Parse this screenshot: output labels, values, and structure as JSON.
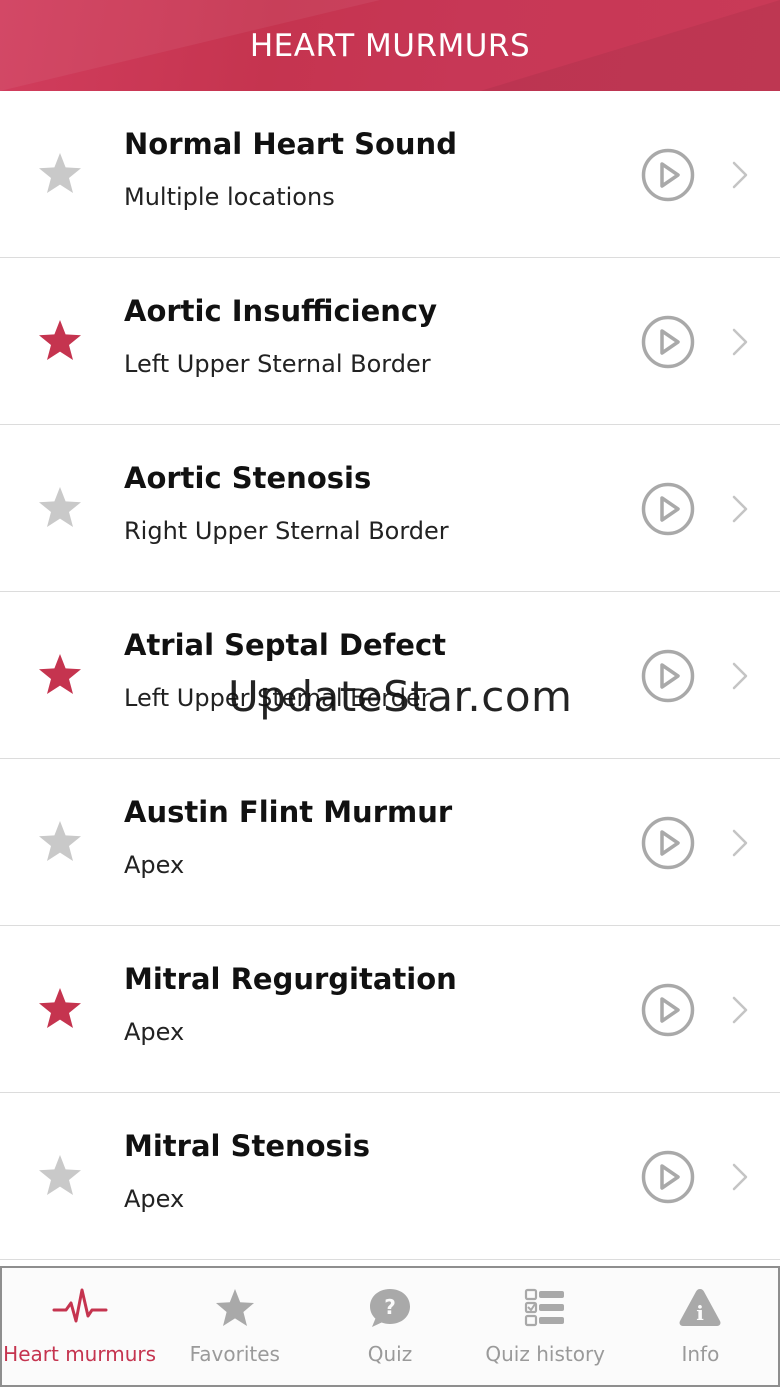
{
  "header": {
    "title": "HEART MURMURS"
  },
  "colors": {
    "accent": "#c5344f",
    "star_off": "#c9c9c9",
    "icon_gray": "#a9a9a9"
  },
  "rows": [
    {
      "name": "Normal Heart Sound",
      "location": "Multiple locations",
      "favorite": false
    },
    {
      "name": "Aortic Insufficiency",
      "location": "Left Upper Sternal Border",
      "favorite": true
    },
    {
      "name": "Aortic Stenosis",
      "location": "Right Upper Sternal Border",
      "favorite": false
    },
    {
      "name": "Atrial Septal Defect",
      "location": "Left Upper Sternal Border",
      "favorite": true
    },
    {
      "name": "Austin Flint Murmur",
      "location": "Apex",
      "favorite": false
    },
    {
      "name": "Mitral Regurgitation",
      "location": "Apex",
      "favorite": true
    },
    {
      "name": "Mitral Stenosis",
      "location": "Apex",
      "favorite": false
    }
  ],
  "watermark": "UpdateStar.com",
  "tabbar": {
    "tabs": [
      {
        "label": "Heart murmurs",
        "icon": "heartbeat-icon",
        "active": true
      },
      {
        "label": "Favorites",
        "icon": "star-icon",
        "active": false
      },
      {
        "label": "Quiz",
        "icon": "question-bubble-icon",
        "active": false
      },
      {
        "label": "Quiz history",
        "icon": "checklist-icon",
        "active": false
      },
      {
        "label": "Info",
        "icon": "info-triangle-icon",
        "active": false
      }
    ]
  }
}
